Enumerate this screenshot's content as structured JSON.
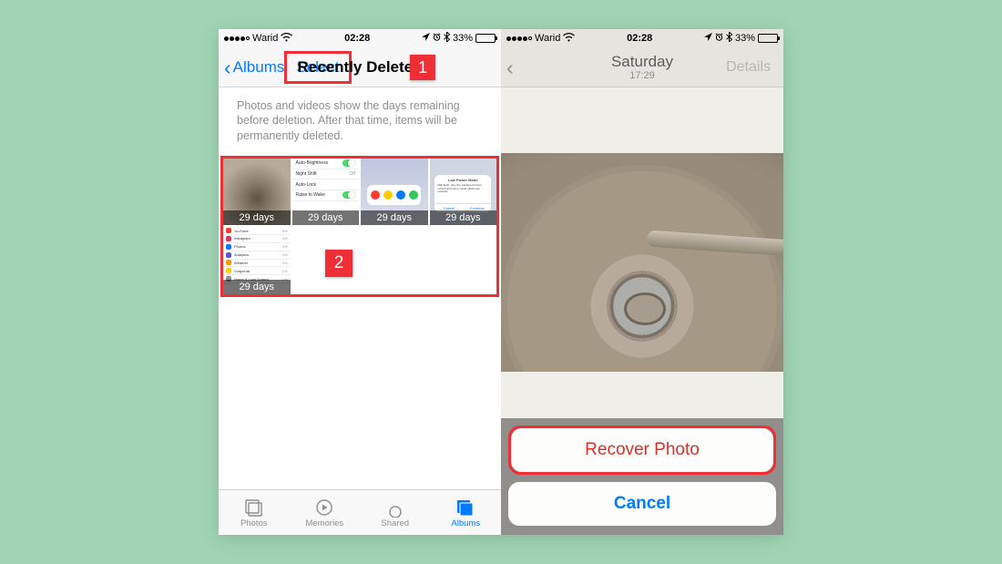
{
  "left": {
    "status": {
      "carrier": "Warid",
      "time": "02:28",
      "battery": "33%"
    },
    "nav": {
      "back": "Albums",
      "title": "Recently Deleted",
      "select": "Select"
    },
    "desc": "Photos and videos show the days remaining before deletion. After that time, items will be permanently deleted.",
    "thumbs": [
      {
        "days": "29 days"
      },
      {
        "days": "29 days"
      },
      {
        "days": "29 days"
      },
      {
        "days": "29 days"
      },
      {
        "days": "29 days"
      }
    ],
    "callout1": "1",
    "callout2": "2",
    "tabs": {
      "photos": "Photos",
      "memories": "Memories",
      "shared": "Shared",
      "albums": "Albums"
    }
  },
  "right": {
    "status": {
      "carrier": "Warid",
      "time": "02:28",
      "battery": "33%"
    },
    "nav": {
      "title": "Saturday",
      "subtitle": "17:29",
      "details": "Details"
    },
    "sheet": {
      "recover": "Recover Photo",
      "cancel": "Cancel"
    }
  }
}
